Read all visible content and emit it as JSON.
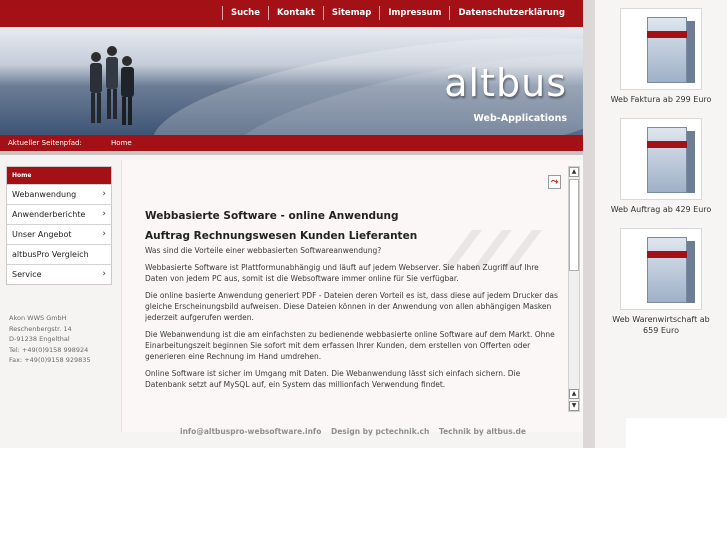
{
  "nav": {
    "items": [
      "Suche",
      "Kontakt",
      "Sitemap",
      "Impressum",
      "Datenschutzerklärung"
    ]
  },
  "banner": {
    "brand": "altbus",
    "subtitle": "Web-Applications"
  },
  "breadcrumb": {
    "label": "Aktueller Seitenpfad:",
    "home": "Home"
  },
  "sidebar": {
    "head": "Home",
    "items": [
      {
        "label": "Webanwendung",
        "has_arrow": true
      },
      {
        "label": "Anwenderberichte",
        "has_arrow": true
      },
      {
        "label": "Unser Angebot",
        "has_arrow": true
      },
      {
        "label": "altbusPro Vergleich",
        "has_arrow": false
      },
      {
        "label": "Service",
        "has_arrow": true
      }
    ],
    "address": [
      "Akon WWS GmbH",
      "Reschenbergstr. 14",
      "D-91238 Engelthal",
      "Tel: +49(0)9158 998924",
      "Fax: +49(0)9158 929835"
    ]
  },
  "article": {
    "title": "Webbasierte Software - online Anwendung",
    "subtitle": "Auftrag Rechnungswesen Kunden Lieferanten",
    "paragraphs": [
      "Was sind die Vorteile einer webbasierten Softwareanwendung?",
      "Webbasierte Software ist Plattformunabhängig und läuft auf jedem Webserver. Sie haben Zugriff auf Ihre Daten von jedem PC aus, somit ist die Websoftware immer online für Sie verfügbar.",
      "Die online basierte Anwendung generiert PDF - Dateien deren Vorteil es ist, dass diese auf jedem Drucker das gleiche Erscheinungsbild aufweisen. Diese Dateien können in der Anwendung von allen abhängigen Masken jederzeit aufgerufen werden.",
      "Die Webanwendung ist die am einfachsten zu bedienende webbasierte online Software auf dem Markt. Ohne Einarbeitungszeit beginnen Sie sofort mit dem erfassen Ihrer Kunden, dem erstellen von Offerten oder generieren eine Rechnung im Hand umdrehen.",
      "Online Software ist sicher im Umgang mit Daten. Die Webanwendung lässt sich einfach sichern. Die Datenbank setzt auf MySQL auf, ein System das millionfach Verwendung findet."
    ]
  },
  "footer": {
    "email": "info@altbuspro-websoftware.info",
    "design": "Design by pctechnik.ch",
    "technik": "Technik by altbus.de"
  },
  "products": [
    {
      "caption": "Web Faktura ab 299 Euro"
    },
    {
      "caption": "Web Auftrag ab 429 Euro"
    },
    {
      "caption_line1": "Web Warenwirtschaft ab",
      "caption_line2": "659 Euro"
    }
  ],
  "colors": {
    "brand_red": "#a31116",
    "banner_blue": "#3f5575",
    "page_bg": "#f6f3f3"
  }
}
